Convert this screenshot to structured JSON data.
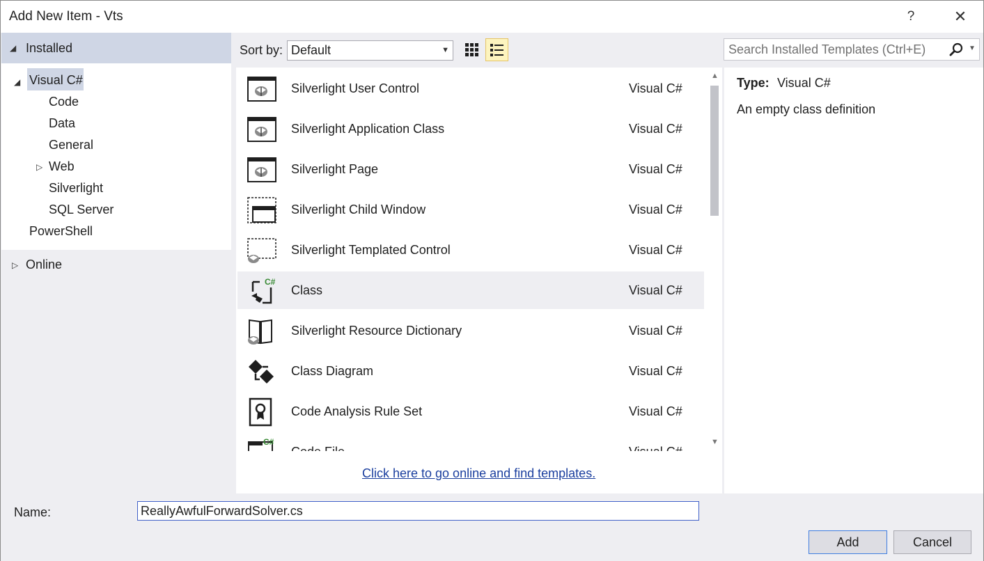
{
  "window": {
    "title": "Add New Item - Vts",
    "help_label": "?",
    "close_label": "✕"
  },
  "tree": {
    "installed": "Installed",
    "visual_csharp": "Visual C#",
    "children": [
      "Code",
      "Data",
      "General",
      "Web",
      "Silverlight",
      "SQL Server"
    ],
    "powershell": "PowerShell",
    "online": "Online"
  },
  "toolbar": {
    "sort_label": "Sort by:",
    "sort_value": "Default"
  },
  "search": {
    "placeholder": "Search Installed Templates (Ctrl+E)"
  },
  "templates": [
    {
      "name": "Silverlight User Control",
      "lang": "Visual C#",
      "icon": "silverlight-user-control-icon"
    },
    {
      "name": "Silverlight Application Class",
      "lang": "Visual C#",
      "icon": "silverlight-application-class-icon"
    },
    {
      "name": "Silverlight Page",
      "lang": "Visual C#",
      "icon": "silverlight-page-icon"
    },
    {
      "name": "Silverlight Child Window",
      "lang": "Visual C#",
      "icon": "silverlight-child-window-icon"
    },
    {
      "name": "Silverlight Templated Control",
      "lang": "Visual C#",
      "icon": "silverlight-templated-control-icon"
    },
    {
      "name": "Class",
      "lang": "Visual C#",
      "icon": "csharp-class-icon",
      "selected": true
    },
    {
      "name": "Silverlight Resource Dictionary",
      "lang": "Visual C#",
      "icon": "resource-dictionary-icon"
    },
    {
      "name": "Class Diagram",
      "lang": "Visual C#",
      "icon": "class-diagram-icon"
    },
    {
      "name": "Code Analysis Rule Set",
      "lang": "Visual C#",
      "icon": "code-analysis-rule-set-icon"
    },
    {
      "name": "Code File",
      "lang": "Visual C#",
      "icon": "code-file-icon"
    }
  ],
  "online_link": "Click here to go online and find templates.",
  "details": {
    "type_label": "Type:",
    "type_value": "Visual C#",
    "description": "An empty class definition"
  },
  "footer": {
    "name_label": "Name:",
    "name_value": "ReallyAwfulForwardSolver.cs",
    "add_label": "Add",
    "cancel_label": "Cancel"
  },
  "colors": {
    "selection": "#cfd6e5",
    "panel_bg": "#eeeef2",
    "link": "#1a3e9e",
    "focus_border": "#3f5fc8"
  }
}
